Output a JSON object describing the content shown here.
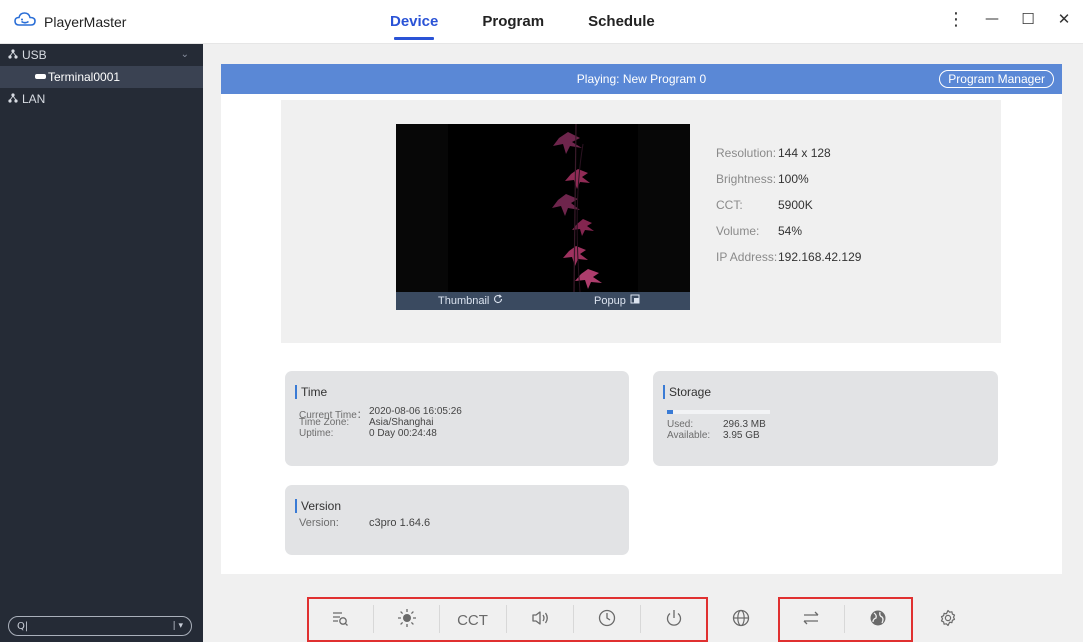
{
  "app": {
    "title": "PlayerMaster"
  },
  "tabs": [
    {
      "label": "Device"
    },
    {
      "label": "Program"
    },
    {
      "label": "Schedule"
    }
  ],
  "window_controls": {
    "more": "⋮",
    "minimize": "—",
    "maximize": "☐",
    "close": "✕"
  },
  "sidebar": {
    "usb_label": "USB",
    "terminal_label": "Terminal0001",
    "lan_label": "LAN",
    "search": {
      "placeholder": "Q|",
      "filter_symbol": "| ▾"
    }
  },
  "playing": {
    "text": "Playing: New Program 0",
    "manager_button": "Program Manager"
  },
  "preview": {
    "thumbnail_label": "Thumbnail",
    "popup_label": "Popup"
  },
  "device_info": [
    {
      "key": "Resolution:",
      "value": "144 x 128"
    },
    {
      "key": "Brightness:",
      "value": "100%"
    },
    {
      "key": "CCT:",
      "value": "5900K"
    },
    {
      "key": "Volume:",
      "value": "54%"
    },
    {
      "key": "IP Address:",
      "value": "192.168.42.129"
    }
  ],
  "time_card": {
    "title": "Time",
    "current_time_key": "Current Time：",
    "current_time_value": "2020-08-06 16:05:26",
    "timezone_key": "Time Zone:",
    "timezone_value": "Asia/Shanghai",
    "uptime_key": "Uptime:",
    "uptime_value": "0 Day 00:24:48"
  },
  "storage_card": {
    "title": "Storage",
    "used_key": "Used:",
    "used_value": "296.3 MB",
    "available_key": "Available:",
    "available_value": "3.95 GB",
    "used_fraction": 0.06
  },
  "version_card": {
    "title": "Version",
    "version_key": "Version:",
    "version_value": "c3pro 1.64.6"
  },
  "toolbar": {
    "cct_label": "CCT",
    "icons": [
      "query-icon",
      "brightness-icon",
      "cct-icon",
      "volume-icon",
      "time-icon",
      "power-icon",
      "network-icon",
      "transfer-icon",
      "globe-icon",
      "settings-icon"
    ]
  },
  "colors": {
    "accent": "#2a53d6",
    "play_bar": "#5a88d6",
    "sidebar": "#252b36",
    "highlight": "#e03030"
  }
}
